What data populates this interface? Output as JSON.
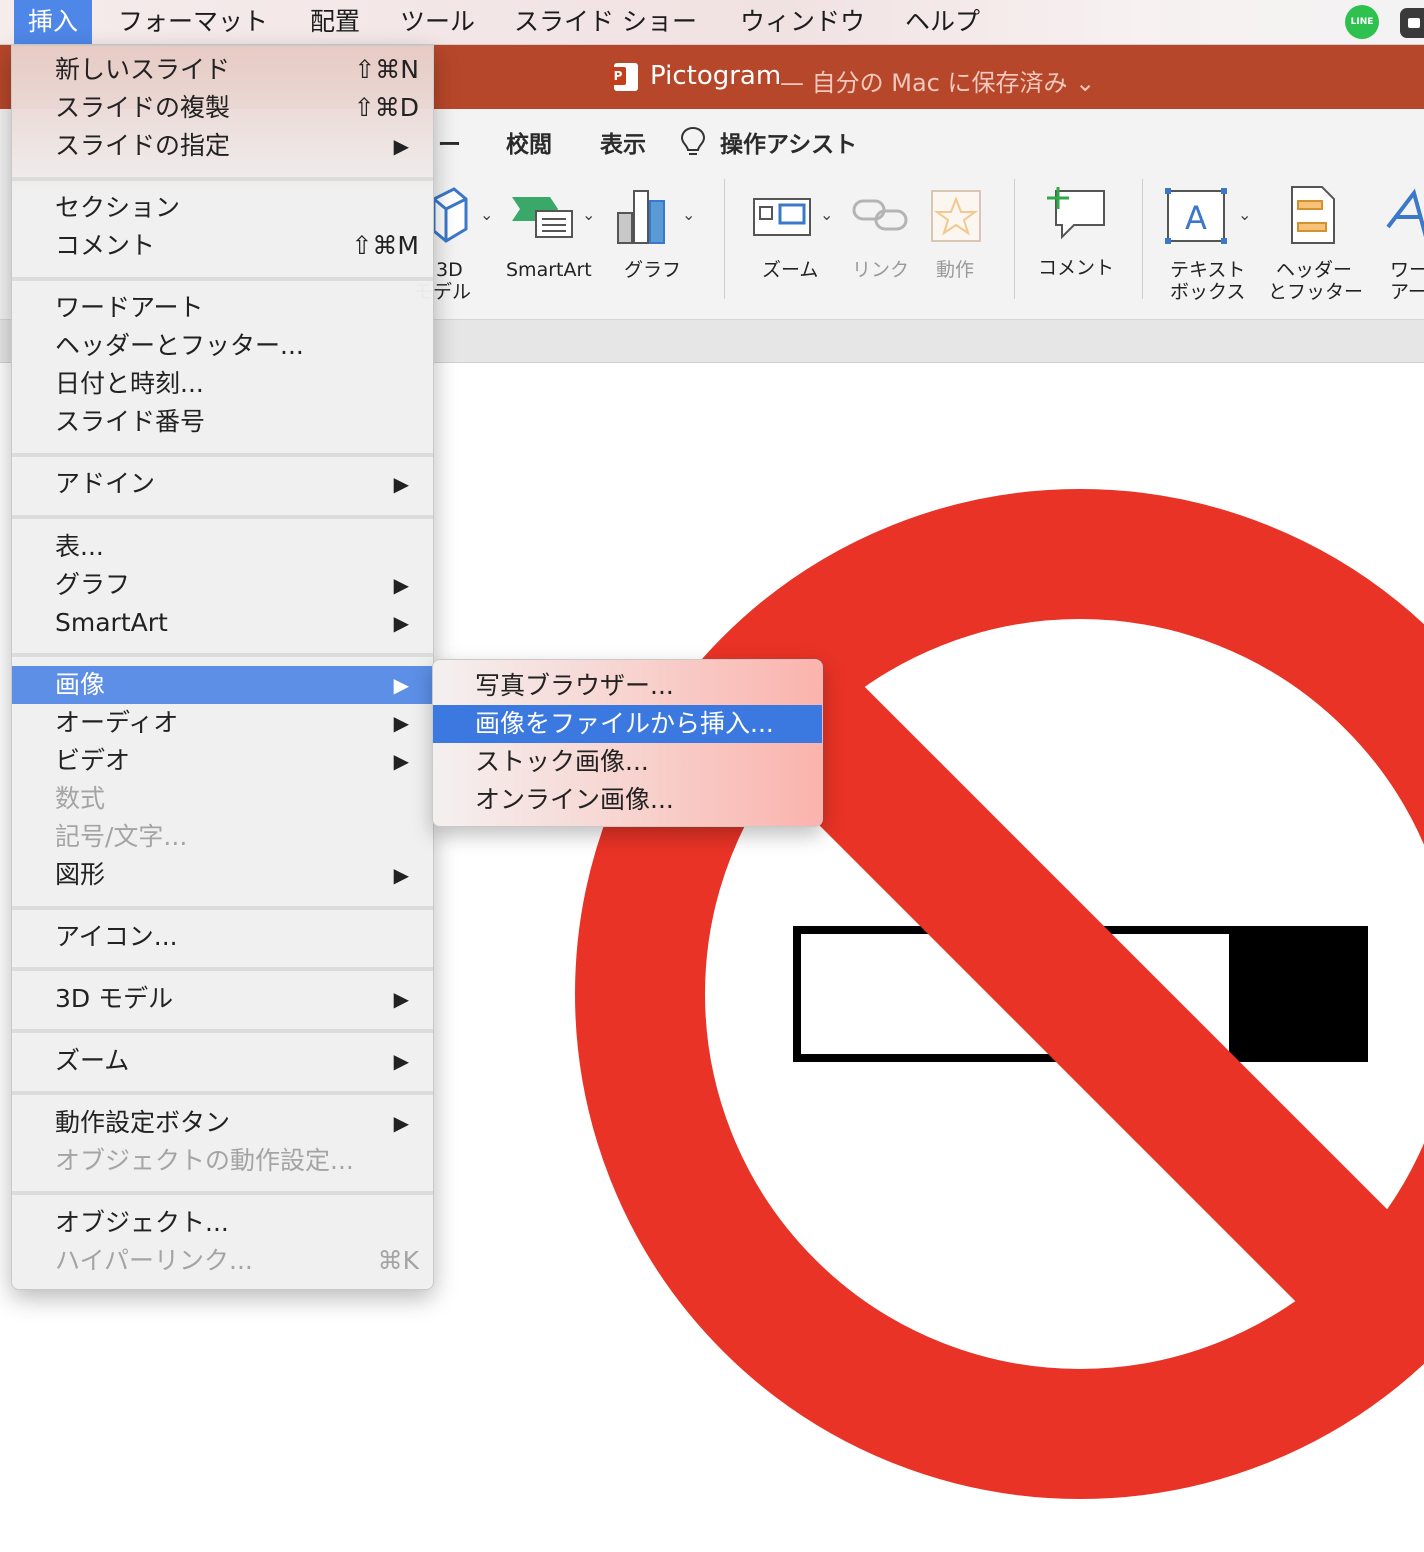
{
  "menubar": {
    "items": [
      "挿入",
      "フォーマット",
      "配置",
      "ツール",
      "スライド ショー",
      "ウィンドウ",
      "ヘルプ"
    ],
    "line_icon_text": "LINE"
  },
  "titlebar": {
    "app_name": "Pictogram",
    "save_status": "— 自分の Mac に保存済み ⌄"
  },
  "ribbon": {
    "tabs": [
      "ー",
      "校閲",
      "表示",
      "操作アシスト"
    ],
    "buttons": {
      "model3d_line1": "3D",
      "model3d_line2": "モデル",
      "smartart": "SmartArt",
      "graph": "グラフ",
      "zoom": "ズーム",
      "link": "リンク",
      "action": "動作",
      "comment": "コメント",
      "textbox_line1": "テキスト",
      "textbox_line2": "ボックス",
      "headerfooter_line1": "ヘッダー",
      "headerfooter_line2": "とフッター",
      "wordart_line1": "ワー",
      "wordart_line2": "アー"
    }
  },
  "insert_menu": {
    "items": [
      {
        "label": "新しいスライド",
        "shortcut": "⇧⌘N"
      },
      {
        "label": "スライドの複製",
        "shortcut": "⇧⌘D"
      },
      {
        "label": "スライドの指定",
        "submenu_arrow": "▶"
      },
      {
        "label": "セクション"
      },
      {
        "label": "コメント",
        "shortcut": "⇧⌘M"
      },
      {
        "label": "ワードアート"
      },
      {
        "label": "ヘッダーとフッター..."
      },
      {
        "label": "日付と時刻..."
      },
      {
        "label": "スライド番号"
      },
      {
        "label": "アドイン",
        "submenu_arrow": "▶"
      },
      {
        "label": "表..."
      },
      {
        "label": "グラフ",
        "submenu_arrow": "▶"
      },
      {
        "label": "SmartArt",
        "submenu_arrow": "▶"
      },
      {
        "label": "画像",
        "submenu_arrow": "▶",
        "highlighted": true
      },
      {
        "label": "オーディオ",
        "submenu_arrow": "▶"
      },
      {
        "label": "ビデオ",
        "submenu_arrow": "▶"
      },
      {
        "label": "数式",
        "disabled": true
      },
      {
        "label": "記号/文字...",
        "disabled": true
      },
      {
        "label": "図形",
        "submenu_arrow": "▶"
      },
      {
        "label": "アイコン..."
      },
      {
        "label": "3D モデル",
        "submenu_arrow": "▶"
      },
      {
        "label": "ズーム",
        "submenu_arrow": "▶"
      },
      {
        "label": "動作設定ボタン",
        "submenu_arrow": "▶"
      },
      {
        "label": "オブジェクトの動作設定...",
        "disabled": true
      },
      {
        "label": "オブジェクト..."
      },
      {
        "label": "ハイパーリンク...",
        "shortcut": "⌘K",
        "disabled": true
      }
    ]
  },
  "image_submenu": {
    "items": [
      {
        "label": "写真ブラウザー..."
      },
      {
        "label": "画像をファイルから挿入...",
        "highlighted": true
      },
      {
        "label": "ストック画像..."
      },
      {
        "label": "オンライン画像..."
      }
    ]
  },
  "slide": {
    "pictogram": "no-smoking",
    "colors": {
      "prohibition_red": "#e83326",
      "cigarette": "#000000"
    }
  },
  "colors": {
    "menu_highlight": "#5d8fe7",
    "submenu_highlight": "#3b78df",
    "title_bar": "#b7472a"
  }
}
